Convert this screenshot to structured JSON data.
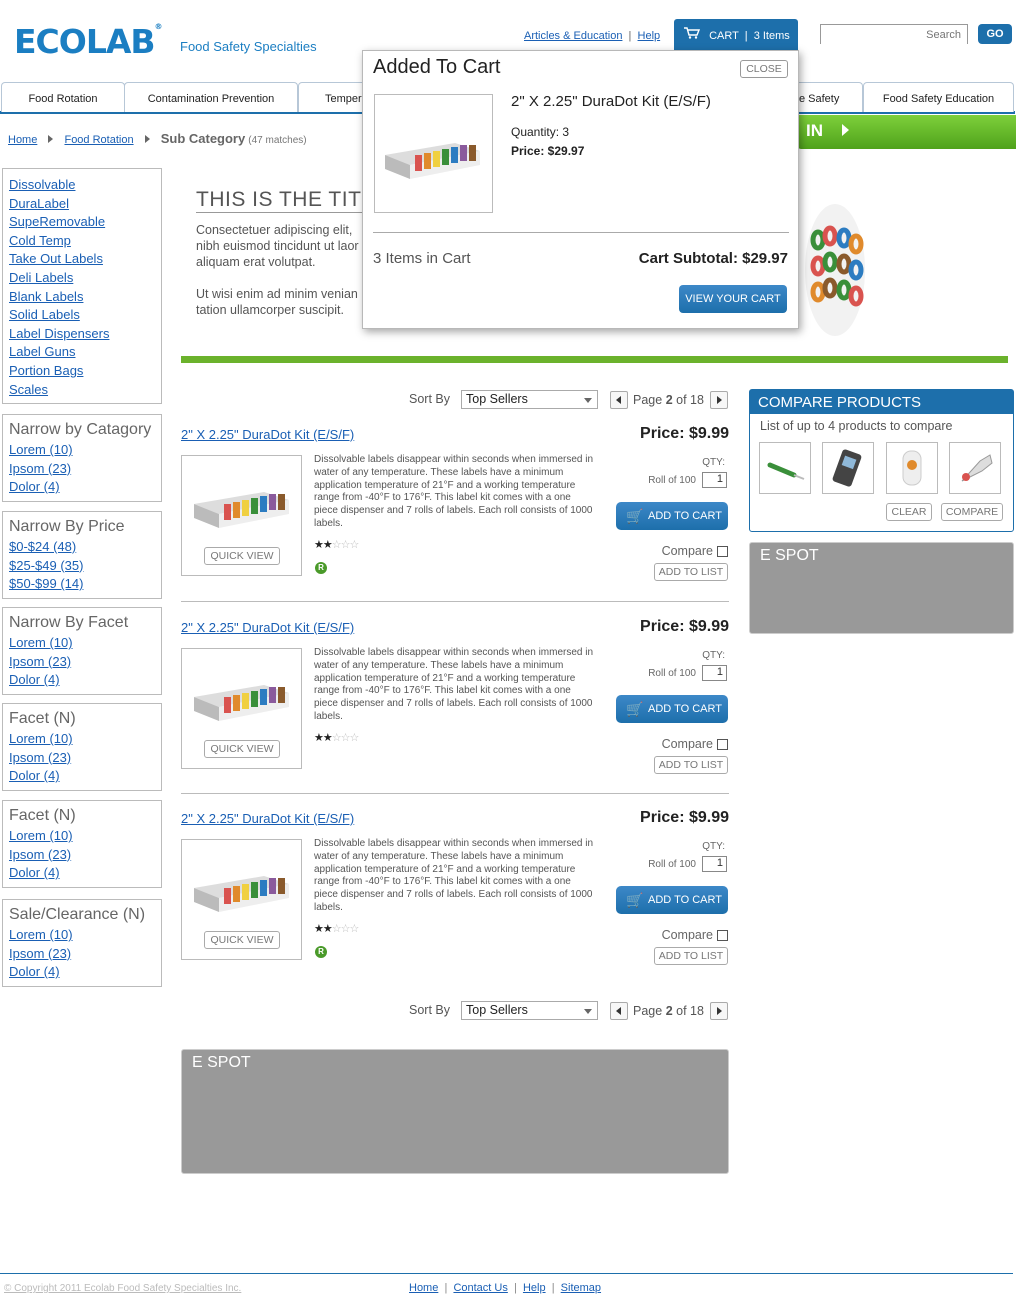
{
  "header": {
    "logo": "ECOLAB",
    "logo_mark": "®",
    "tagline": "Food Safety Specialties",
    "articles_link": "Articles & Education",
    "help_link": "Help",
    "cart_label": "CART",
    "cart_items": "3 Items",
    "search_placeholder": "Search",
    "go_label": "GO"
  },
  "nav": {
    "tabs": [
      {
        "label": "Food Rotation"
      },
      {
        "label": "Contamination Prevention"
      },
      {
        "label": "Tempera"
      },
      {
        "label": "e Safety"
      },
      {
        "label": "Food Safety Education"
      }
    ]
  },
  "breadcrumb": {
    "home": "Home",
    "food_rotation": "Food Rotation",
    "current": "Sub Category",
    "matches": "(47 matches)"
  },
  "sidebar": {
    "categories": [
      "Dissolvable",
      "DuraLabel",
      "SupeRemovable",
      "Cold Temp",
      "Take Out Labels",
      "Deli Labels",
      "Blank Labels",
      "Solid Labels",
      "Label Dispensers",
      "Label Guns",
      "Portion Bags",
      "Scales"
    ],
    "facets": [
      {
        "title": "Narrow by Catagory",
        "items": [
          "Lorem (10)",
          "Ipsom (23)",
          "Dolor (4)"
        ]
      },
      {
        "title": "Narrow By Price",
        "items": [
          "$0-$24 (48)",
          "$25-$49 (35)",
          "$50-$99 (14)"
        ]
      },
      {
        "title": "Narrow By Facet",
        "items": [
          "Lorem (10)",
          "Ipsom (23)",
          "Dolor (4)"
        ]
      },
      {
        "title": "Facet (N)",
        "items": [
          "Lorem (10)",
          "Ipsom (23)",
          "Dolor (4)"
        ]
      },
      {
        "title": "Facet (N)",
        "items": [
          "Lorem (10)",
          "Ipsom (23)",
          "Dolor (4)"
        ]
      },
      {
        "title": "Sale/Clearance (N)",
        "items": [
          "Lorem (10)",
          "Ipsom (23)",
          "Dolor (4)"
        ]
      }
    ]
  },
  "hero": {
    "title": "THIS IS THE TITL",
    "text1": "Consectetuer adipiscing elit, nibh euismod tincidunt ut laor aliquam erat volutpat.",
    "text2": "Ut wisi enim ad minim venian tation ullamcorper suscipit.",
    "banner_text": "IN"
  },
  "sort": {
    "label": "Sort By",
    "value": "Top Sellers",
    "page_prefix": "Page",
    "page_current": "2",
    "page_of": "of 18"
  },
  "products": [
    {
      "title": "2\" X 2.25\" DuraDot Kit (E/S/F)",
      "price": "Price: $9.99",
      "desc": "Dissolvable labels disappear within seconds when immersed in water of any temperature. These labels have a minimum application temperature of 21°F and a working temperature range from -40°F to 176°F. This label kit comes with a one piece dispenser and 7 rolls of labels. Each roll consists of 1000 labels.",
      "qty_label": "QTY:",
      "roll_label": "Roll of 100",
      "qty": "1",
      "add_label": "ADD TO CART",
      "compare_label": "Compare",
      "list_label": "ADD TO LIST",
      "quick_view": "QUICK VIEW",
      "rating": 2,
      "badge": "R"
    },
    {
      "title": "2\" X 2.25\" DuraDot Kit (E/S/F)",
      "price": "Price: $9.99",
      "desc": "Dissolvable labels disappear within seconds when immersed in water of any temperature. These labels have a minimum application temperature of 21°F and a working temperature range from -40°F to 176°F. This label kit comes with a one piece dispenser and 7 rolls of labels. Each roll consists of 1000 labels.",
      "qty_label": "QTY:",
      "roll_label": "Roll of 100",
      "qty": "1",
      "add_label": "ADD TO CART",
      "compare_label": "Compare",
      "list_label": "ADD TO LIST",
      "quick_view": "QUICK VIEW",
      "rating": 2,
      "badge": ""
    },
    {
      "title": "2\" X 2.25\" DuraDot Kit (E/S/F)",
      "price": "Price: $9.99",
      "desc": "Dissolvable labels disappear within seconds when immersed in water of any temperature. These labels have a minimum application temperature of 21°F and a working temperature range from -40°F to 176°F. This label kit comes with a one piece dispenser and 7 rolls of labels. Each roll consists of 1000 labels.",
      "qty_label": "QTY:",
      "roll_label": "Roll of 100",
      "qty": "1",
      "add_label": "ADD TO CART",
      "compare_label": "Compare",
      "list_label": "ADD TO LIST",
      "quick_view": "QUICK VIEW",
      "rating": 2,
      "badge": "R"
    }
  ],
  "compare": {
    "title": "COMPARE PRODUCTS",
    "subtitle": "List of up to 4 products to compare",
    "clear_label": "CLEAR",
    "compare_label": "COMPARE"
  },
  "espot": {
    "side_label": "E SPOT",
    "bottom_label": "E SPOT"
  },
  "popup": {
    "title": "Added To Cart",
    "close_label": "CLOSE",
    "product_name": "2\" X 2.25\" DuraDot Kit (E/S/F)",
    "quantity": "Quantity: 3",
    "price": "Price: $29.97",
    "items_in_cart": "3 Items in Cart",
    "subtotal": "Cart Subtotal: $29.97",
    "view_cart_label": "VIEW YOUR CART"
  },
  "footer": {
    "copyright": "© Copyright 2011 Ecolab Food Safety Specialties Inc.",
    "links": [
      "Home",
      "Contact Us",
      "Help",
      "Sitemap"
    ]
  },
  "colors": {
    "brand_blue": "#1d6fab",
    "link_blue": "#1a5fb4",
    "accent_green": "#6bb22c",
    "espot_gray": "#999999"
  }
}
